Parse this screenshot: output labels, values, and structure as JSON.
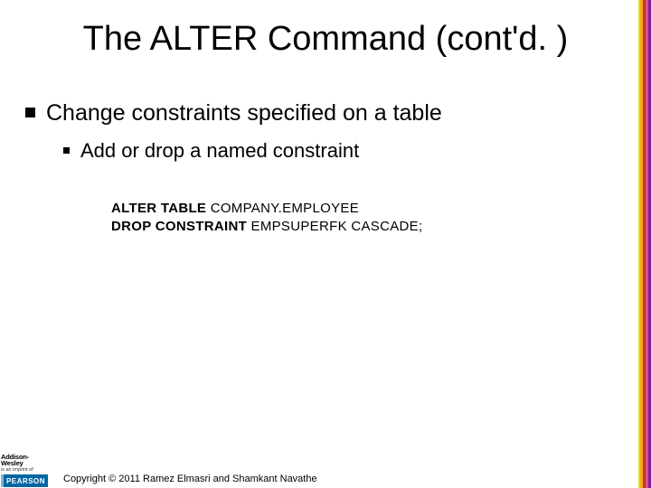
{
  "title": "The ALTER Command (cont'd. )",
  "bullets": {
    "l1": "Change constraints specified on a table",
    "l2": "Add or drop a named constraint"
  },
  "code": {
    "line1": {
      "kw": "ALTER TABLE",
      "rest": " COMPANY.EMPLOYEE"
    },
    "line2": {
      "kw": "DROP CONSTRAINT",
      "rest1": " EMPSUPERFK ",
      "kw2": "CASCADE;",
      "rest2": ""
    }
  },
  "footer": {
    "aw_top": "Addison-Wesley",
    "aw_sub": "is an imprint of",
    "pearson": "PEARSON",
    "copyright": "Copyright © 2011 Ramez Elmasri and Shamkant Navathe"
  }
}
